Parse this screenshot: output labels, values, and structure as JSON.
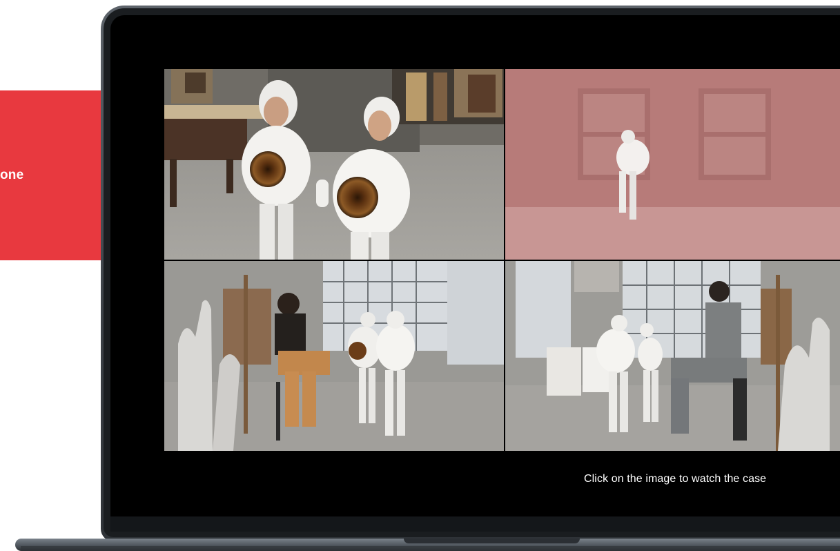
{
  "side_card": {
    "text": "one",
    "color": "#e8393f"
  },
  "player": {
    "caption": "Click on the image to watch the case",
    "panels": [
      {
        "id": "top-left",
        "scene": "studio-eye-costumes"
      },
      {
        "id": "top-right",
        "scene": "pink-room-doors"
      },
      {
        "id": "bottom-left",
        "scene": "art-studio-seated-woman"
      },
      {
        "id": "bottom-right",
        "scene": "art-studio-seated-man"
      }
    ]
  },
  "colors": {
    "accent": "#e8393f",
    "screen_background": "#000000",
    "caption_text": "#ffffff"
  }
}
